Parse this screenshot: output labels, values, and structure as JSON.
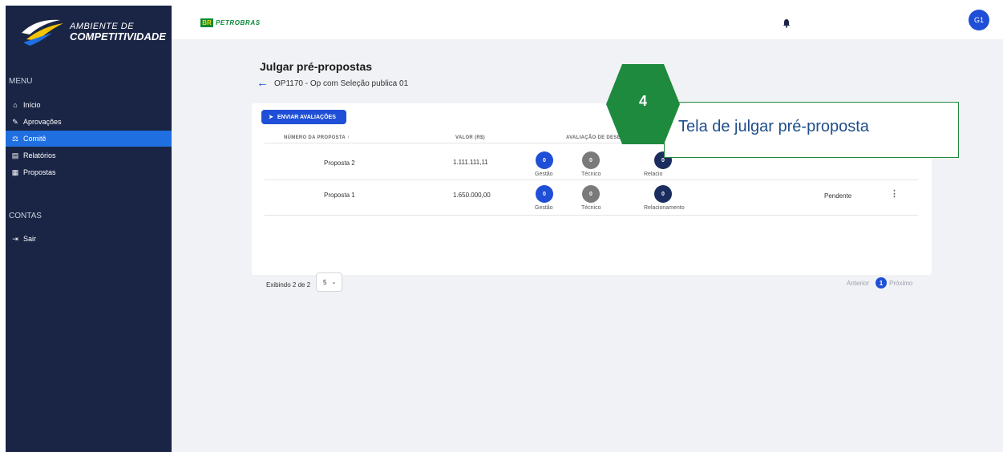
{
  "sidebar": {
    "logo_line1": "AMBIENTE DE",
    "logo_line2": "COMPETITIVIDADE",
    "menu_title": "MENU",
    "items": [
      {
        "label": "Início",
        "icon": "home-icon"
      },
      {
        "label": "Aprovações",
        "icon": "gavel-icon"
      },
      {
        "label": "Comitê",
        "icon": "scale-icon",
        "active": true
      },
      {
        "label": "Relatórios",
        "icon": "document-icon"
      },
      {
        "label": "Propostas",
        "icon": "proposals-icon"
      }
    ],
    "accounts_title": "CONTAS",
    "logout_label": "Sair"
  },
  "topbar": {
    "brand_badge": "BR",
    "brand_name": "PETROBRAS",
    "avatar_initials": "G1"
  },
  "page": {
    "title": "Julgar pré-propostas",
    "subtitle": "OP1170 - Op com Seleção publica 01"
  },
  "toolbar": {
    "send_label": "ENVIAR AVALIAÇÕES"
  },
  "table": {
    "headers": [
      "NÚMERO DA PROPOSTA ↑",
      "VALOR (R$)",
      "AVALIAÇÃO DE DESE"
    ],
    "rows": [
      {
        "name": "Proposta 2",
        "value": "1.111.111,11",
        "ratings": [
          {
            "score": "0",
            "label": "Gestão"
          },
          {
            "score": "0",
            "label": "Técnico"
          },
          {
            "score": "0",
            "label": "Relacio"
          }
        ],
        "status": ""
      },
      {
        "name": "Proposta 1",
        "value": "1.650.000,00",
        "ratings": [
          {
            "score": "0",
            "label": "Gestão"
          },
          {
            "score": "0",
            "label": "Técnico"
          },
          {
            "score": "0",
            "label": "Relacionamento"
          }
        ],
        "status": "Pendente"
      }
    ]
  },
  "pagination": {
    "showing_text": "Exibindo 2 de 2",
    "page_size": "5",
    "prev_label": "Anterior",
    "current_page": "1",
    "next_label": "Próximo"
  },
  "callout": {
    "step": "4",
    "text": "Tela de julgar pré-proposta"
  },
  "colors": {
    "sidebar_bg": "#1a2545",
    "accent": "#1f4fd6",
    "callout_green": "#1e8a3e",
    "callout_text": "#1f4e8c"
  }
}
